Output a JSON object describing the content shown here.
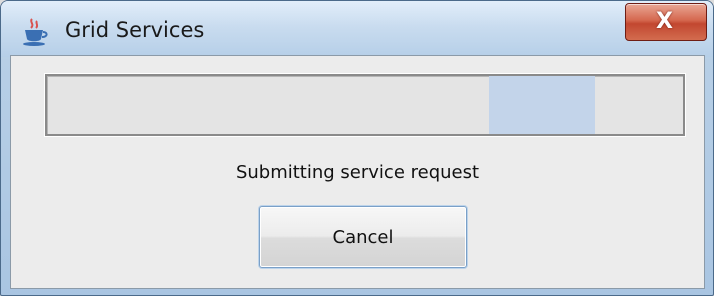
{
  "window": {
    "title": "Grid Services",
    "app_icon": "java-coffee-cup-icon",
    "close_icon": "close-icon",
    "close_glyph": "X"
  },
  "progress": {
    "mode": "indeterminate",
    "chunk_color": "#c3d4ea"
  },
  "status": {
    "message": "Submitting service request"
  },
  "buttons": {
    "cancel_label": "Cancel"
  },
  "colors": {
    "close_button": "#c24730",
    "title_bar": "#c9dcef"
  }
}
